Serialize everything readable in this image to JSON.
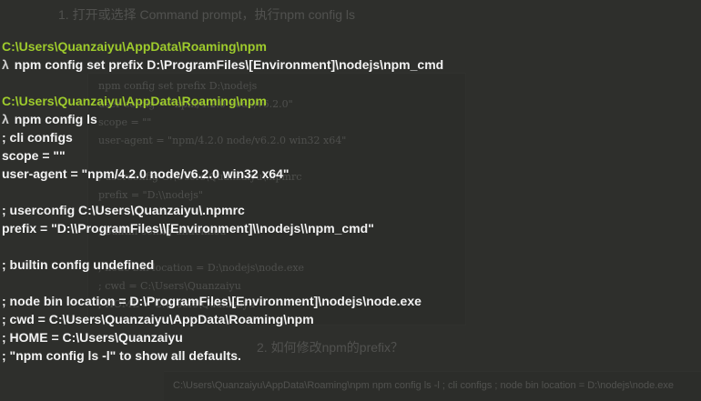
{
  "background_ghost": {
    "top_text": "1. 打开或选择 Command prompt，执行npm config ls",
    "panel_lines": [
      "npm config set prefix D:\\nodejs",
      "user-config = \"npm/4.2.0 node/v6.2.0\"",
      "scope = \"\"",
      "user-agent = \"npm/4.2.0 node/v6.2.0 win32 x64\"",
      "",
      "; userconfig C:\\Users\\Quanzaiyu\\.npmrc",
      "prefix = \"D:\\\\nodejs\"",
      "",
      "; builtin config undefined",
      "",
      "; node bin location = D:\\nodejs\\node.exe",
      "; cwd = C:\\Users\\Quanzaiyu",
      "; HOME = C:\\Users\\Quanzaiyu"
    ],
    "mid_text": "2. 如何修改npm的prefix？",
    "bottom_text": "C:\\Users\\Quanzaiyu\\AppData\\Roaming\\npm  npm config ls -l   ; cli configs  ; node bin location = D:\\nodejs\\node.exe"
  },
  "console": {
    "prompt_symbol": "λ",
    "lines": [
      {
        "kind": "path",
        "text": "C:\\Users\\Quanzaiyu\\AppData\\Roaming\\npm"
      },
      {
        "kind": "cmd",
        "text": "npm config set prefix D:\\ProgramFiles\\[Environment]\\nodejs\\npm_cmd"
      },
      {
        "kind": "blank",
        "text": ""
      },
      {
        "kind": "path",
        "text": "C:\\Users\\Quanzaiyu\\AppData\\Roaming\\npm"
      },
      {
        "kind": "cmd",
        "text": "npm config ls"
      },
      {
        "kind": "out",
        "text": "; cli configs"
      },
      {
        "kind": "out",
        "text": "scope = \"\""
      },
      {
        "kind": "out",
        "text": "user-agent = \"npm/4.2.0 node/v6.2.0 win32 x64\""
      },
      {
        "kind": "blank",
        "text": ""
      },
      {
        "kind": "out",
        "text": "; userconfig C:\\Users\\Quanzaiyu\\.npmrc"
      },
      {
        "kind": "out",
        "text": "prefix = \"D:\\\\ProgramFiles\\\\[Environment]\\\\nodejs\\\\npm_cmd\""
      },
      {
        "kind": "blank",
        "text": ""
      },
      {
        "kind": "out",
        "text": "; builtin config undefined"
      },
      {
        "kind": "blank",
        "text": ""
      },
      {
        "kind": "out",
        "text": "; node bin location = D:\\ProgramFiles\\[Environment]\\nodejs\\node.exe"
      },
      {
        "kind": "out",
        "text": "; cwd = C:\\Users\\Quanzaiyu\\AppData\\Roaming\\npm"
      },
      {
        "kind": "out",
        "text": "; HOME = C:\\Users\\Quanzaiyu"
      },
      {
        "kind": "out",
        "text": "; \"npm config ls -l\" to show all defaults."
      }
    ]
  }
}
